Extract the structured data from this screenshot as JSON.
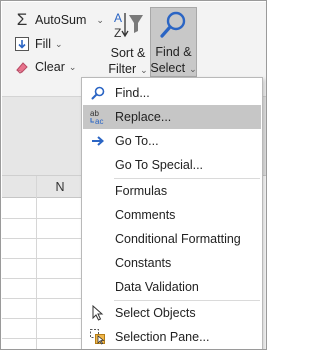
{
  "ribbon": {
    "autosum_label": "AutoSum",
    "fill_label": "Fill",
    "clear_label": "Clear",
    "sort_filter_line1": "Sort &",
    "sort_filter_line2": "Filter",
    "find_select_line1": "Find &",
    "find_select_line2": "Select"
  },
  "sheet": {
    "column_header": "N"
  },
  "menu": {
    "items": [
      {
        "label": "Find...",
        "icon": "search-icon"
      },
      {
        "label": "Replace...",
        "icon": "replace-icon"
      },
      {
        "label": "Go To...",
        "icon": "arrow-right-icon"
      },
      {
        "label": "Go To Special...",
        "icon": ""
      },
      {
        "label": "Formulas",
        "icon": ""
      },
      {
        "label": "Comments",
        "icon": ""
      },
      {
        "label": "Conditional Formatting",
        "icon": ""
      },
      {
        "label": "Constants",
        "icon": ""
      },
      {
        "label": "Data Validation",
        "icon": ""
      },
      {
        "label": "Select Objects",
        "icon": "select-objects-icon"
      },
      {
        "label": "Selection Pane...",
        "icon": "selection-pane-icon"
      }
    ],
    "hovered": "Replace..."
  },
  "colors": {
    "accent_blue": "#2b65c4",
    "hover_gray": "#c6c6c6"
  }
}
